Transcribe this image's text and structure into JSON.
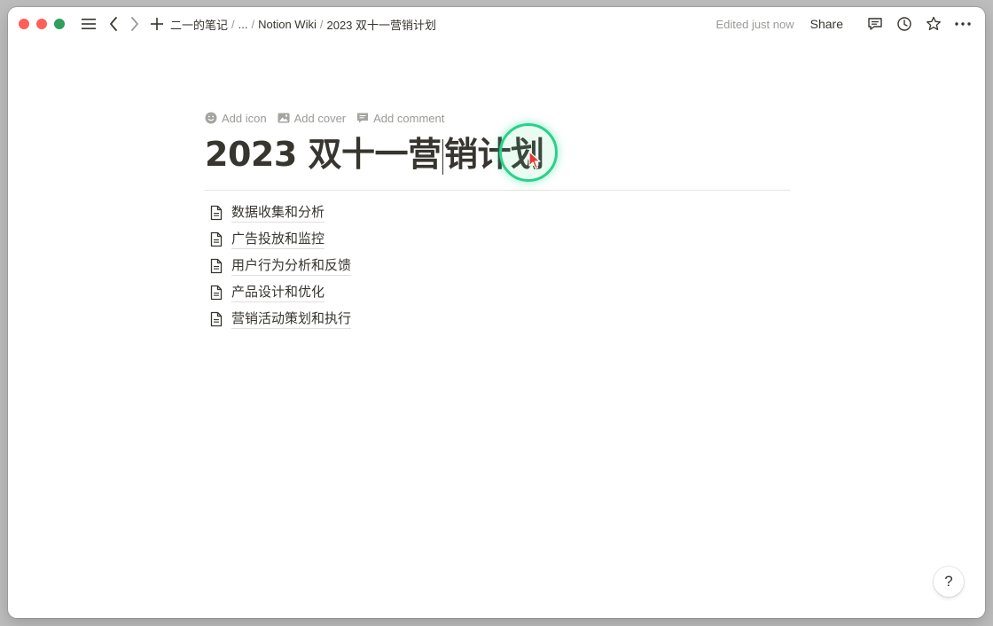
{
  "window": {
    "traffic_colors": {
      "close": "#fe5f57",
      "minimize": "#fe5f57",
      "zoom": "#2fa05c"
    }
  },
  "topbar": {
    "icons": [
      "menu-icon",
      "back-icon",
      "forward-icon",
      "new-page-icon"
    ],
    "breadcrumbs": [
      {
        "label": "二一的笔记"
      },
      {
        "label": "..."
      },
      {
        "label": "Notion Wiki"
      },
      {
        "label": "2023 双十一营销计划"
      }
    ],
    "separator": "/",
    "edited": "Edited just now",
    "share": "Share",
    "right_icons": [
      "comment-icon",
      "history-icon",
      "favorite-star-icon",
      "more-icon"
    ]
  },
  "page": {
    "actions": {
      "add_icon": "Add icon",
      "add_cover": "Add cover",
      "add_comment": "Add comment"
    },
    "title_before_caret": "2023 双十一营",
    "title_after_caret": "销计划",
    "subpages": [
      {
        "label": "数据收集和分析"
      },
      {
        "label": "广告投放和监控"
      },
      {
        "label": "用户行为分析和反馈"
      },
      {
        "label": "产品设计和优化"
      },
      {
        "label": "营销活动策划和执行"
      }
    ]
  },
  "help": {
    "label": "?"
  },
  "colors": {
    "text": "#37352f",
    "muted": "#9b9a97",
    "cursor_ring": "#25d38a",
    "pointer": "#e53935"
  }
}
